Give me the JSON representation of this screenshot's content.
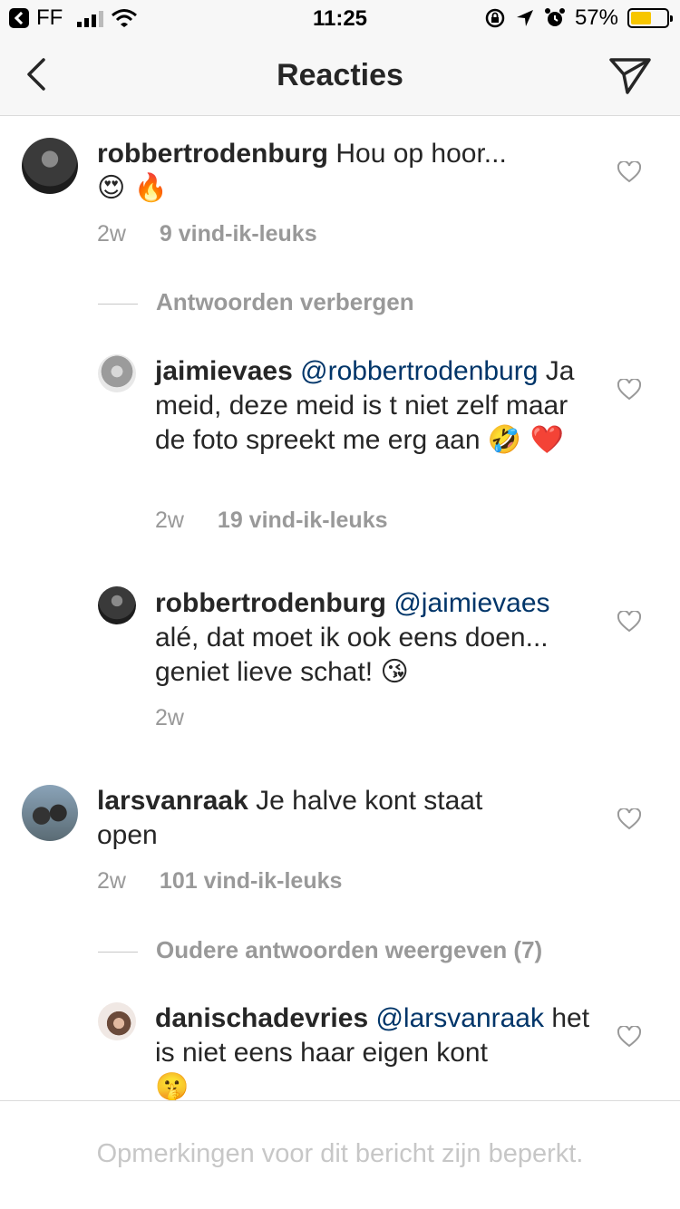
{
  "status_bar": {
    "carrier": "FF",
    "time": "11:25",
    "battery": "57%",
    "battery_level": 0.57
  },
  "nav": {
    "title": "Reacties",
    "back_icon": "chevron-left-icon",
    "send_icon": "paper-plane-icon"
  },
  "comments": [
    {
      "username": "robbertrodenburg",
      "mention": "",
      "text": "Hou op hoor...",
      "emoji": "😍 🔥",
      "time": "2w",
      "likes": "9 vind-ik-leuks"
    },
    {
      "username": "jaimievaes",
      "mention": "@robbertrodenburg",
      "text": "Ja meid, deze meid is t niet zelf maar de foto spreekt me erg aan",
      "emoji": "🤣 ❤️",
      "time": "2w",
      "likes": "19 vind-ik-leuks"
    },
    {
      "username": "robbertrodenburg",
      "mention": "@jaimievaes",
      "text": "alé, dat moet ik ook eens doen... geniet lieve schat!",
      "emoji": "😘",
      "time": "2w",
      "likes": ""
    },
    {
      "username": "larsvanraak",
      "mention": "",
      "text": "Je halve kont staat open",
      "emoji": "",
      "time": "2w",
      "likes": "101 vind-ik-leuks"
    },
    {
      "username": "danischadevries",
      "mention": "@larsvanraak",
      "text": "het is niet eens haar eigen kont",
      "emoji": "🤫",
      "time": "",
      "likes": ""
    }
  ],
  "toggles": {
    "hide_replies": "Antwoorden verbergen",
    "show_older": "Oudere antwoorden weergeven (7)"
  },
  "footer": {
    "message": "Opmerkingen voor dit bericht zijn beperkt."
  }
}
